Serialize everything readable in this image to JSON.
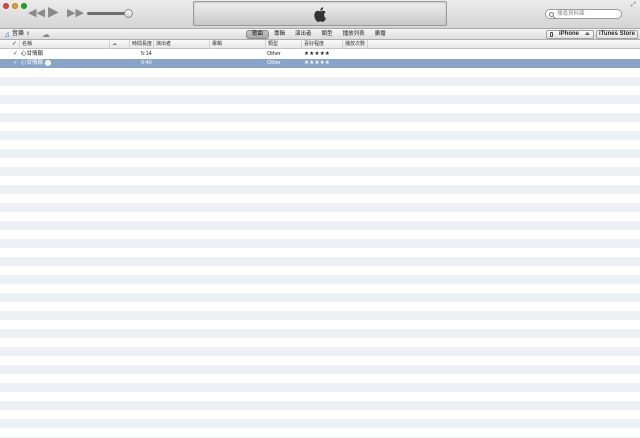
{
  "toolbar": {
    "rewind_icon": "◀◀",
    "play_icon": "▶",
    "ffwd_icon": "▶▶",
    "volume_fraction": 0.9,
    "search_placeholder": "搜尋資料庫",
    "fullscreen_icon": "⤢"
  },
  "navbar": {
    "library_label": "音樂",
    "tabs": [
      "歌曲",
      "專輯",
      "演出者",
      "類型",
      "播放列表",
      "廣播"
    ],
    "active_tab_index": 0,
    "device_label": "iPhone",
    "store_label": "iTunes Store"
  },
  "columns": {
    "check": "✓",
    "name": "名稱",
    "time": "時間長度",
    "artist": "演出者",
    "album": "專輯",
    "genre": "類型",
    "rating": "喜好程度",
    "plays": "播放次數"
  },
  "rows": [
    {
      "check": "✓",
      "name": "心甘情願",
      "time": "5:14",
      "genre": "Other",
      "rating": "★★★★★",
      "selected": false
    },
    {
      "check": "✓",
      "name": "心甘情願",
      "time": "0:40",
      "genre": "Other",
      "rating": "★★★★★",
      "selected": true
    }
  ],
  "colors": {
    "selection": "#87a3c7",
    "stripe": "#edf0f5",
    "accent": "#2f6fd6"
  }
}
